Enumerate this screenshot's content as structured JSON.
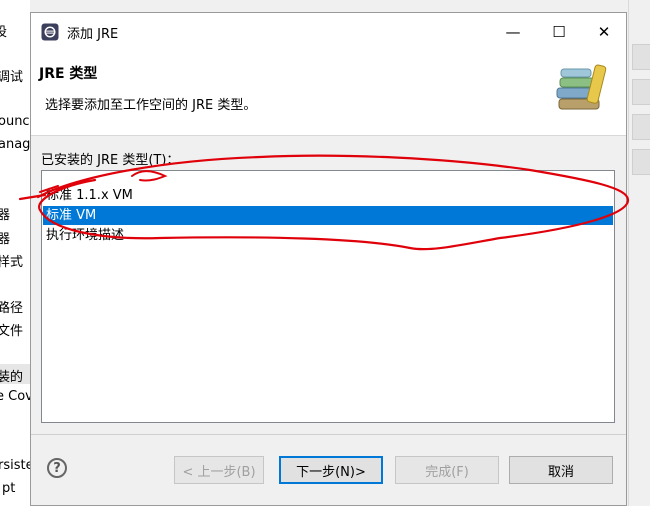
{
  "background_window": {
    "left_items": [
      "设",
      "调试",
      "ounc",
      "anag",
      "器",
      "器",
      "样式",
      "路径",
      "文件",
      "装的",
      "e Cov",
      "rsiste",
      "pt"
    ]
  },
  "dialog": {
    "title": "添加 JRE",
    "controls": {
      "minimize": "—",
      "maximize": "☐",
      "close": "✕"
    },
    "header": {
      "title": "JRE 类型",
      "description": "选择要添加至工作空间的 JRE 类型。"
    },
    "list_label": "已安装的 JRE 类型(T)：",
    "jre_types": [
      {
        "label": "标准 1.1.x VM"
      },
      {
        "label": "标准 VM",
        "selected": true
      },
      {
        "label": "执行环境描述"
      }
    ],
    "buttons": {
      "back": "< 上一步(B)",
      "next": "下一步(N)>",
      "finish": "完成(F)",
      "cancel": "取消"
    },
    "help_icon": "?"
  },
  "colors": {
    "selection": "#0078d7",
    "annotation": "#e0000a"
  }
}
